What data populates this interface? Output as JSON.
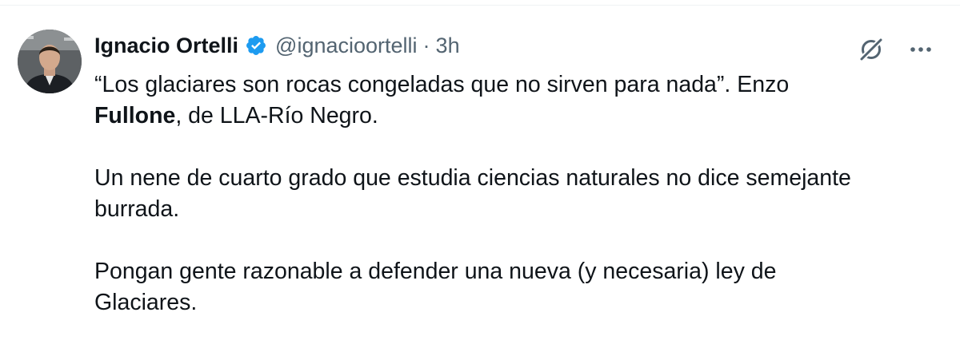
{
  "tweet": {
    "author": {
      "display_name": "Ignacio Ortelli",
      "verified": true,
      "handle": "@ignacioortelli",
      "separator": "·",
      "timestamp": "3h",
      "avatar_icon": "profile-photo"
    },
    "actions": {
      "grok_icon": "grok-icon",
      "more_icon": "more-options-icon"
    },
    "paragraphs": [
      {
        "part1": "“Los glaciares son rocas congeladas que no sirven para nada”. Enzo",
        "bold": "Fullone",
        "part2": ", de LLA-Río Negro."
      },
      {
        "line1": "Un nene de cuarto grado que estudia ciencias naturales no dice semejante",
        "line2": "burrada."
      },
      {
        "line1": "Pongan gente razonable a defender una nueva (y necesaria) ley de",
        "line2": "Glaciares."
      }
    ]
  },
  "colors": {
    "text_primary": "#0f1419",
    "text_secondary": "#536471",
    "verified_blue": "#1d9bf0",
    "divider": "#eff3f4"
  }
}
